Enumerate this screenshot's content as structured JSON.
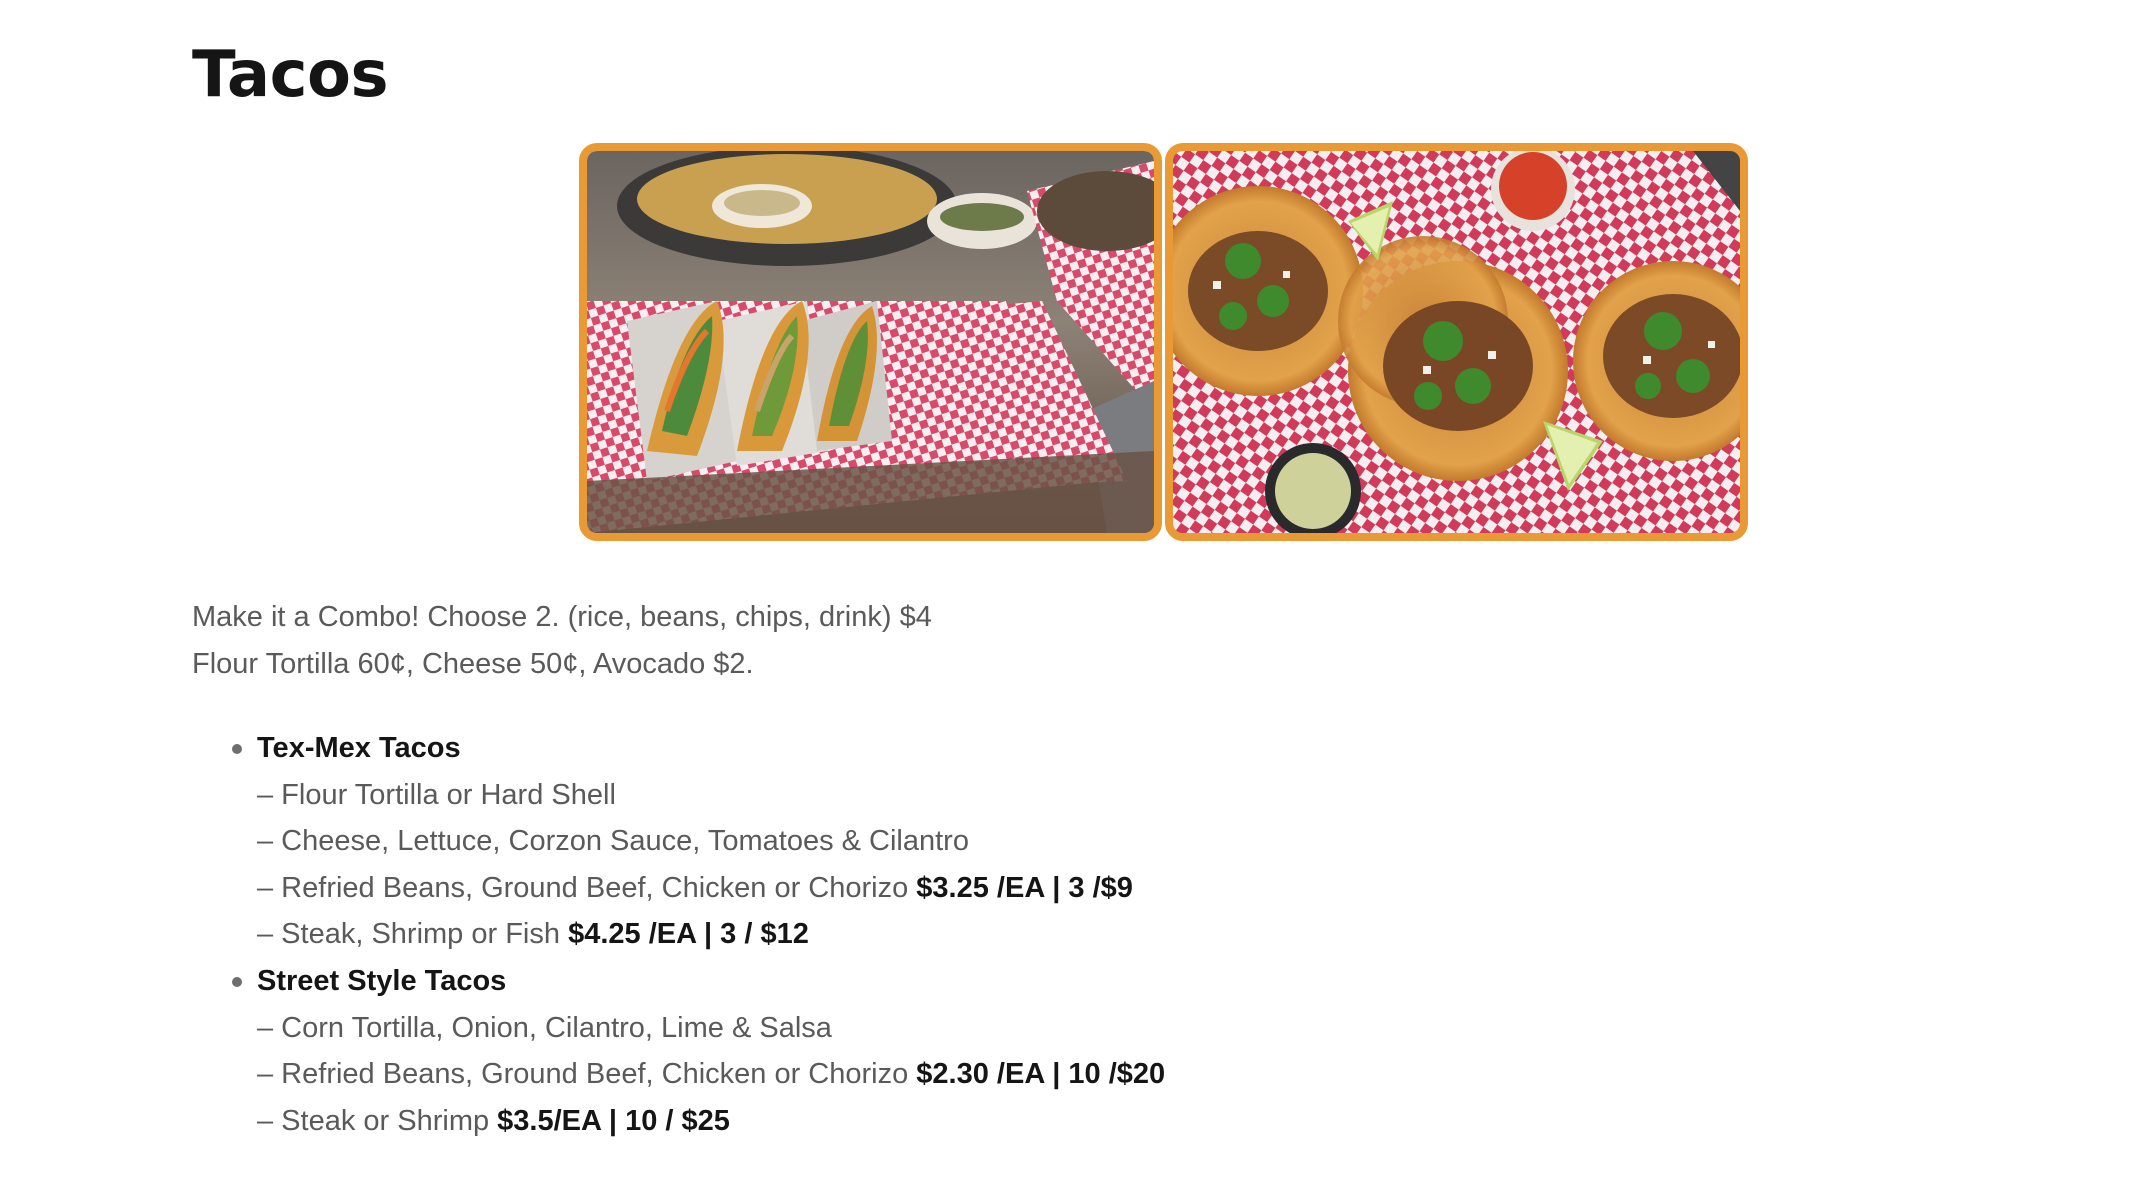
{
  "page": {
    "title": "Tacos"
  },
  "gallery": {
    "border_color": "#e99a35",
    "images": [
      {
        "name": "tex-mex-tacos-photo"
      },
      {
        "name": "street-tacos-photo"
      }
    ]
  },
  "description": {
    "combo": "Make it a Combo! Choose 2. (rice, beans, chips, drink) $4",
    "extras": "Flour Tortilla 60¢, Cheese 50¢, Avocado $2."
  },
  "menu": {
    "items": [
      {
        "name": "Tex-Mex Tacos",
        "lines": [
          {
            "text": "– Flour Tortilla or Hard Shell",
            "price": ""
          },
          {
            "text": "– Cheese, Lettuce, Corzon Sauce, Tomatoes & Cilantro",
            "price": ""
          },
          {
            "text": "– Refried Beans, Ground Beef, Chicken or Chorizo ",
            "price": "$3.25 /EA | 3 /$9"
          },
          {
            "text": "– Steak, Shrimp or Fish ",
            "price": "$4.25 /EA | 3 / $12"
          }
        ]
      },
      {
        "name": "Street Style Tacos",
        "lines": [
          {
            "text": "– Corn Tortilla, Onion, Cilantro, Lime & Salsa",
            "price": ""
          },
          {
            "text": "– Refried Beans, Ground Beef, Chicken or Chorizo ",
            "price": "$2.30 /EA | 10 /$20"
          },
          {
            "text": "– Steak or Shrimp ",
            "price": "$3.5/EA | 10 / $25"
          }
        ]
      }
    ]
  }
}
